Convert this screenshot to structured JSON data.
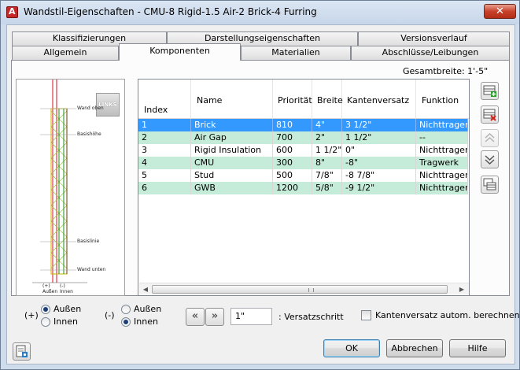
{
  "window": {
    "title": "Wandstil-Eigenschaften - CMU-8 Rigid-1.5 Air-2 Brick-4 Furring",
    "close_label": "✕"
  },
  "tabs": {
    "row1": [
      {
        "label": "Klassifizierungen"
      },
      {
        "label": "Darstellungseigenschaften"
      },
      {
        "label": "Versionsverlauf"
      }
    ],
    "row2": [
      {
        "label": "Allgemein"
      },
      {
        "label": "Komponenten"
      },
      {
        "label": "Materialien"
      },
      {
        "label": "Abschlüsse/Leibungen"
      }
    ],
    "active": "Komponenten"
  },
  "overall_width": "Gesamtbreite: 1'-5\"",
  "preview": {
    "badge": "LINKS",
    "labels": {
      "wand_oben": "Wand oben",
      "basishoehe": "Basishöhe",
      "basislinie": "Basislinie",
      "wand_unten": "Wand unten",
      "plus_aussen": "(+)\nAußen",
      "minus_innen": "(-)\nInnen"
    }
  },
  "table": {
    "headers": [
      "Index",
      "Name",
      "Priorität",
      "Breite",
      "Kantenversatz",
      "Funktion"
    ],
    "rows": [
      [
        "1",
        "Brick",
        "810",
        "4\"",
        "3 1/2\"",
        "Nichttragend"
      ],
      [
        "2",
        "Air Gap",
        "700",
        "2\"",
        "1 1/2\"",
        "--"
      ],
      [
        "3",
        "Rigid Insulation",
        "600",
        "1 1/2\"",
        "0\"",
        "Nichttragend"
      ],
      [
        "4",
        "CMU",
        "300",
        "8\"",
        "-8\"",
        "Tragwerk"
      ],
      [
        "5",
        "Stud",
        "500",
        "7/8\"",
        "-8 7/8\"",
        "Nichttragend"
      ],
      [
        "6",
        "GWB",
        "1200",
        "5/8\"",
        "-9 1/2\"",
        "Nichttragend"
      ]
    ],
    "selected_row": 0
  },
  "side_buttons": [
    "add-component-icon",
    "delete-component-icon",
    "move-up-icon",
    "move-down-icon",
    "copy-component-icon"
  ],
  "controls": {
    "plus_label": "(+)",
    "minus_label": "(-)",
    "left_group": {
      "options": [
        "Außen",
        "Innen"
      ],
      "selected": "Außen"
    },
    "right_group": {
      "options": [
        "Außen",
        "Innen"
      ],
      "selected": "Innen"
    },
    "prev_label": "«",
    "next_label": "»",
    "offset_step_value": "1\"",
    "offset_step_label": ": Versatzschritt",
    "auto_offset_label": "Kantenversatz autom. berechnen",
    "auto_offset_checked": false
  },
  "footer": {
    "ok": "OK",
    "cancel": "Abbrechen",
    "help": "Hilfe"
  },
  "colors": {
    "selection": "#3399ff",
    "alt_row": "#c5ecd8",
    "title_bg": "#cfdcec",
    "close_red": "#c8412a"
  }
}
